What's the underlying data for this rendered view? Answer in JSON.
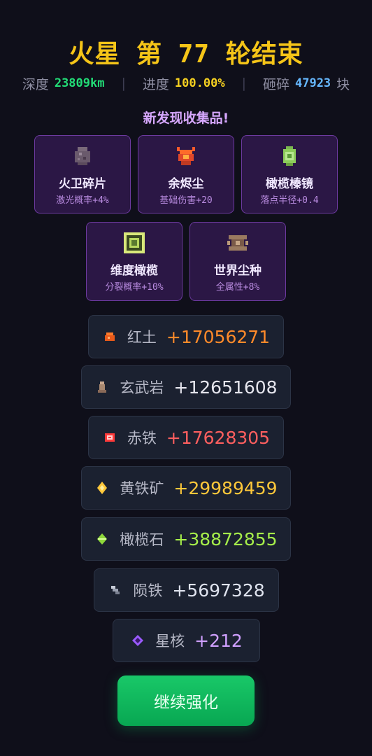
{
  "title": "火星 第 77 轮结束",
  "stats": {
    "depth_label": "深度",
    "depth_value": "23809km",
    "depth_color": "#22dd77",
    "progress_label": "进度",
    "progress_value": "100.00%",
    "progress_color": "#f5d020",
    "crush_label": "砸碎",
    "crush_value": "47923",
    "crush_unit": "块",
    "crush_color": "#66b8ff"
  },
  "discover_title": "新发现收集品!",
  "collectibles": [
    {
      "name": "火卫碎片",
      "effect": "激光概率+4%",
      "icon": "rock-fragment-icon"
    },
    {
      "name": "余烬尘",
      "effect": "基础伤害+20",
      "icon": "ember-icon"
    },
    {
      "name": "橄榄榛镜",
      "effect": "落点半径+0.4",
      "icon": "olive-gem-icon"
    },
    {
      "name": "维度橄榄",
      "effect": "分裂概率+10%",
      "icon": "dimension-square-icon"
    },
    {
      "name": "世界尘种",
      "effect": "全属性+8%",
      "icon": "dust-seed-icon"
    }
  ],
  "resources": [
    {
      "name": "红土",
      "value": "+17056271",
      "color": "#ff8a2a",
      "icon": "red-soil-icon"
    },
    {
      "name": "玄武岩",
      "value": "+12651608",
      "color": "#e6e6ee",
      "icon": "basalt-icon"
    },
    {
      "name": "赤铁",
      "value": "+17628305",
      "color": "#ff5f5f",
      "icon": "hematite-icon"
    },
    {
      "name": "黄铁矿",
      "value": "+29989459",
      "color": "#ffc83a",
      "icon": "pyrite-icon"
    },
    {
      "name": "橄榄石",
      "value": "+38872855",
      "color": "#a6ee4a",
      "icon": "olivine-icon"
    },
    {
      "name": "陨铁",
      "value": "+5697328",
      "color": "#dfe3ee",
      "icon": "meteorite-iron-icon"
    },
    {
      "name": "星核",
      "value": "+212",
      "color": "#d0a0ff",
      "icon": "star-core-icon"
    }
  ],
  "continue_label": "继续强化"
}
